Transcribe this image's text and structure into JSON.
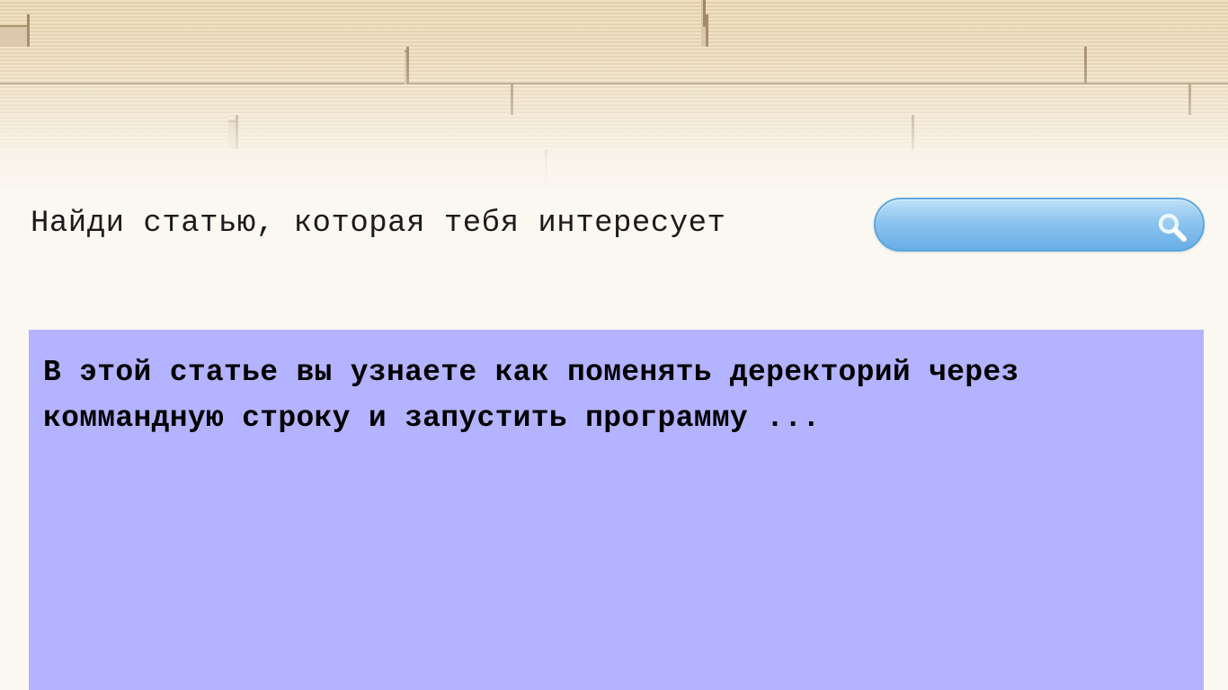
{
  "search": {
    "prompt": "Найди статью, которая тебя интересует",
    "value": "",
    "placeholder": ""
  },
  "article": {
    "excerpt": "В этой статье вы узнаете как поменять деректорий через коммандную строку и запустить программу ..."
  },
  "colors": {
    "background": "#fbf7f1",
    "card": "#b3b3ff",
    "search_border": "#5aa7e0",
    "search_fill": "#8cc4ef"
  },
  "icons": {
    "search": "search-icon"
  }
}
